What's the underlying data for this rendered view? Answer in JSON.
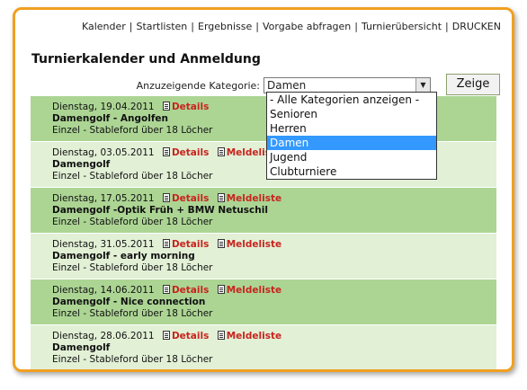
{
  "nav": [
    "Kalender",
    "Startlisten",
    "Ergebnisse",
    "Vorgabe abfragen",
    "Turnierübersicht",
    "DRUCKEN"
  ],
  "page_title": "Turnierkalender und Anmeldung",
  "filter": {
    "label": "Anzuzeigende Kategorie:",
    "selected": "Damen",
    "options": [
      "- Alle Kategorien anzeigen -",
      "Senioren",
      "Herren",
      "Damen",
      "Jugend",
      "Clubturniere"
    ],
    "button": "Zeige"
  },
  "events": [
    {
      "date": "Dienstag, 19.04.2011",
      "name": "Damengolf - Angolfen",
      "format": "Einzel - Stableford über 18 Löcher",
      "details": "Details",
      "meldeliste": ""
    },
    {
      "date": "Dienstag, 03.05.2011",
      "name": "Damengolf",
      "format": "Einzel - Stableford über 18 Löcher",
      "details": "Details",
      "meldeliste": "Meldeliste"
    },
    {
      "date": "Dienstag, 17.05.2011",
      "name": "Damengolf -Optik Früh + BMW Netuschil",
      "format": "Einzel - Stableford über 18 Löcher",
      "details": "Details",
      "meldeliste": "Meldeliste"
    },
    {
      "date": "Dienstag, 31.05.2011",
      "name": "Damengolf - early morning",
      "format": "Einzel - Stableford über 18 Löcher",
      "details": "Details",
      "meldeliste": "Meldeliste"
    },
    {
      "date": "Dienstag, 14.06.2011",
      "name": "Damengolf - Nice connection",
      "format": "Einzel - Stableford über 18 Löcher",
      "details": "Details",
      "meldeliste": "Meldeliste"
    },
    {
      "date": "Dienstag, 28.06.2011",
      "name": "Damengolf",
      "format": "Einzel - Stableford über 18 Löcher",
      "details": "Details",
      "meldeliste": "Meldeliste"
    }
  ]
}
